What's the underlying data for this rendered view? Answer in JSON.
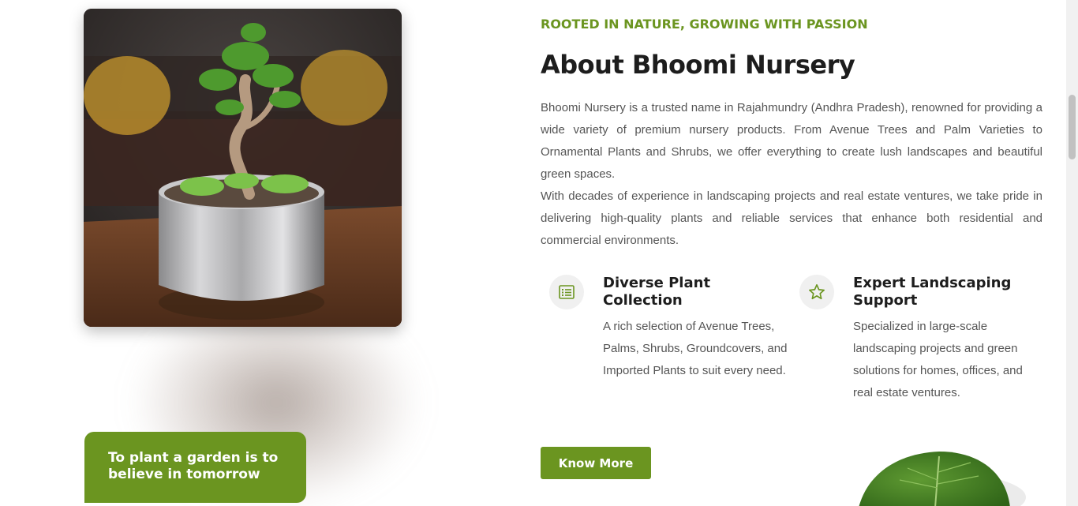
{
  "about": {
    "eyebrow": "ROOTED IN NATURE, GROWING WITH PASSION",
    "heading": "About Bhoomi Nursery",
    "paragraphs": [
      "Bhoomi Nursery is a trusted name in Rajahmundry (Andhra Pradesh), renowned for providing a wide variety of premium nursery products. From Avenue Trees and Palm Varieties to Ornamental Plants and Shrubs, we offer everything to create lush landscapes and beautiful green spaces.",
      "With decades of experience in landscaping projects and real estate ventures, we take pride in delivering high-quality plants and reliable services that enhance both residential and commercial environments."
    ],
    "features": [
      {
        "icon": "list-icon",
        "title": "Diverse Plant Collection",
        "description": "A rich selection of Avenue Trees, Palms, Shrubs, Groundcovers, and Imported Plants to suit every need."
      },
      {
        "icon": "star-icon",
        "title": "Expert Landscaping Support",
        "description": "Specialized in large-scale landscaping projects and green solutions for homes, offices, and real estate ventures."
      }
    ],
    "cta_label": "Know More"
  },
  "quote": {
    "text": "To plant a garden is to believe in tomorrow"
  },
  "images": {
    "main_photo": "bonsai-plant-in-steel-pot-photo",
    "decor": "green-leaf-image"
  },
  "colors": {
    "accent": "#6b9520",
    "heading": "#1d1d1d",
    "body_text": "#555555",
    "icon_bg": "#f0f0f0"
  }
}
